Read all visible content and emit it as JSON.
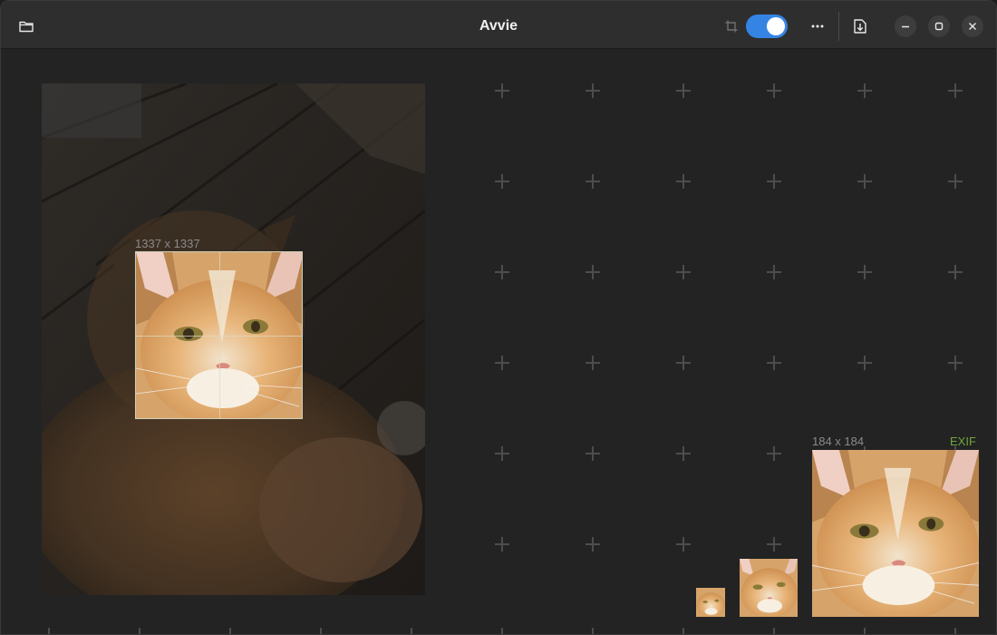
{
  "app": {
    "title": "Avvie"
  },
  "headerbar": {
    "open_icon": "folder-icon",
    "crop_icon": "crop-icon",
    "toggle_on": true,
    "menu_icon": "ellipsis-icon",
    "export_icon": "document-save-icon",
    "minimize_icon": "minimize-icon",
    "maximize_icon": "maximize-icon",
    "close_icon": "close-icon"
  },
  "editor": {
    "crop_size_label": "1337 x 1337",
    "preview_size_label": "184 x 184",
    "exif_label": "EXIF"
  },
  "colors": {
    "accent": "#3584e4",
    "exif": "#6fa63e"
  }
}
